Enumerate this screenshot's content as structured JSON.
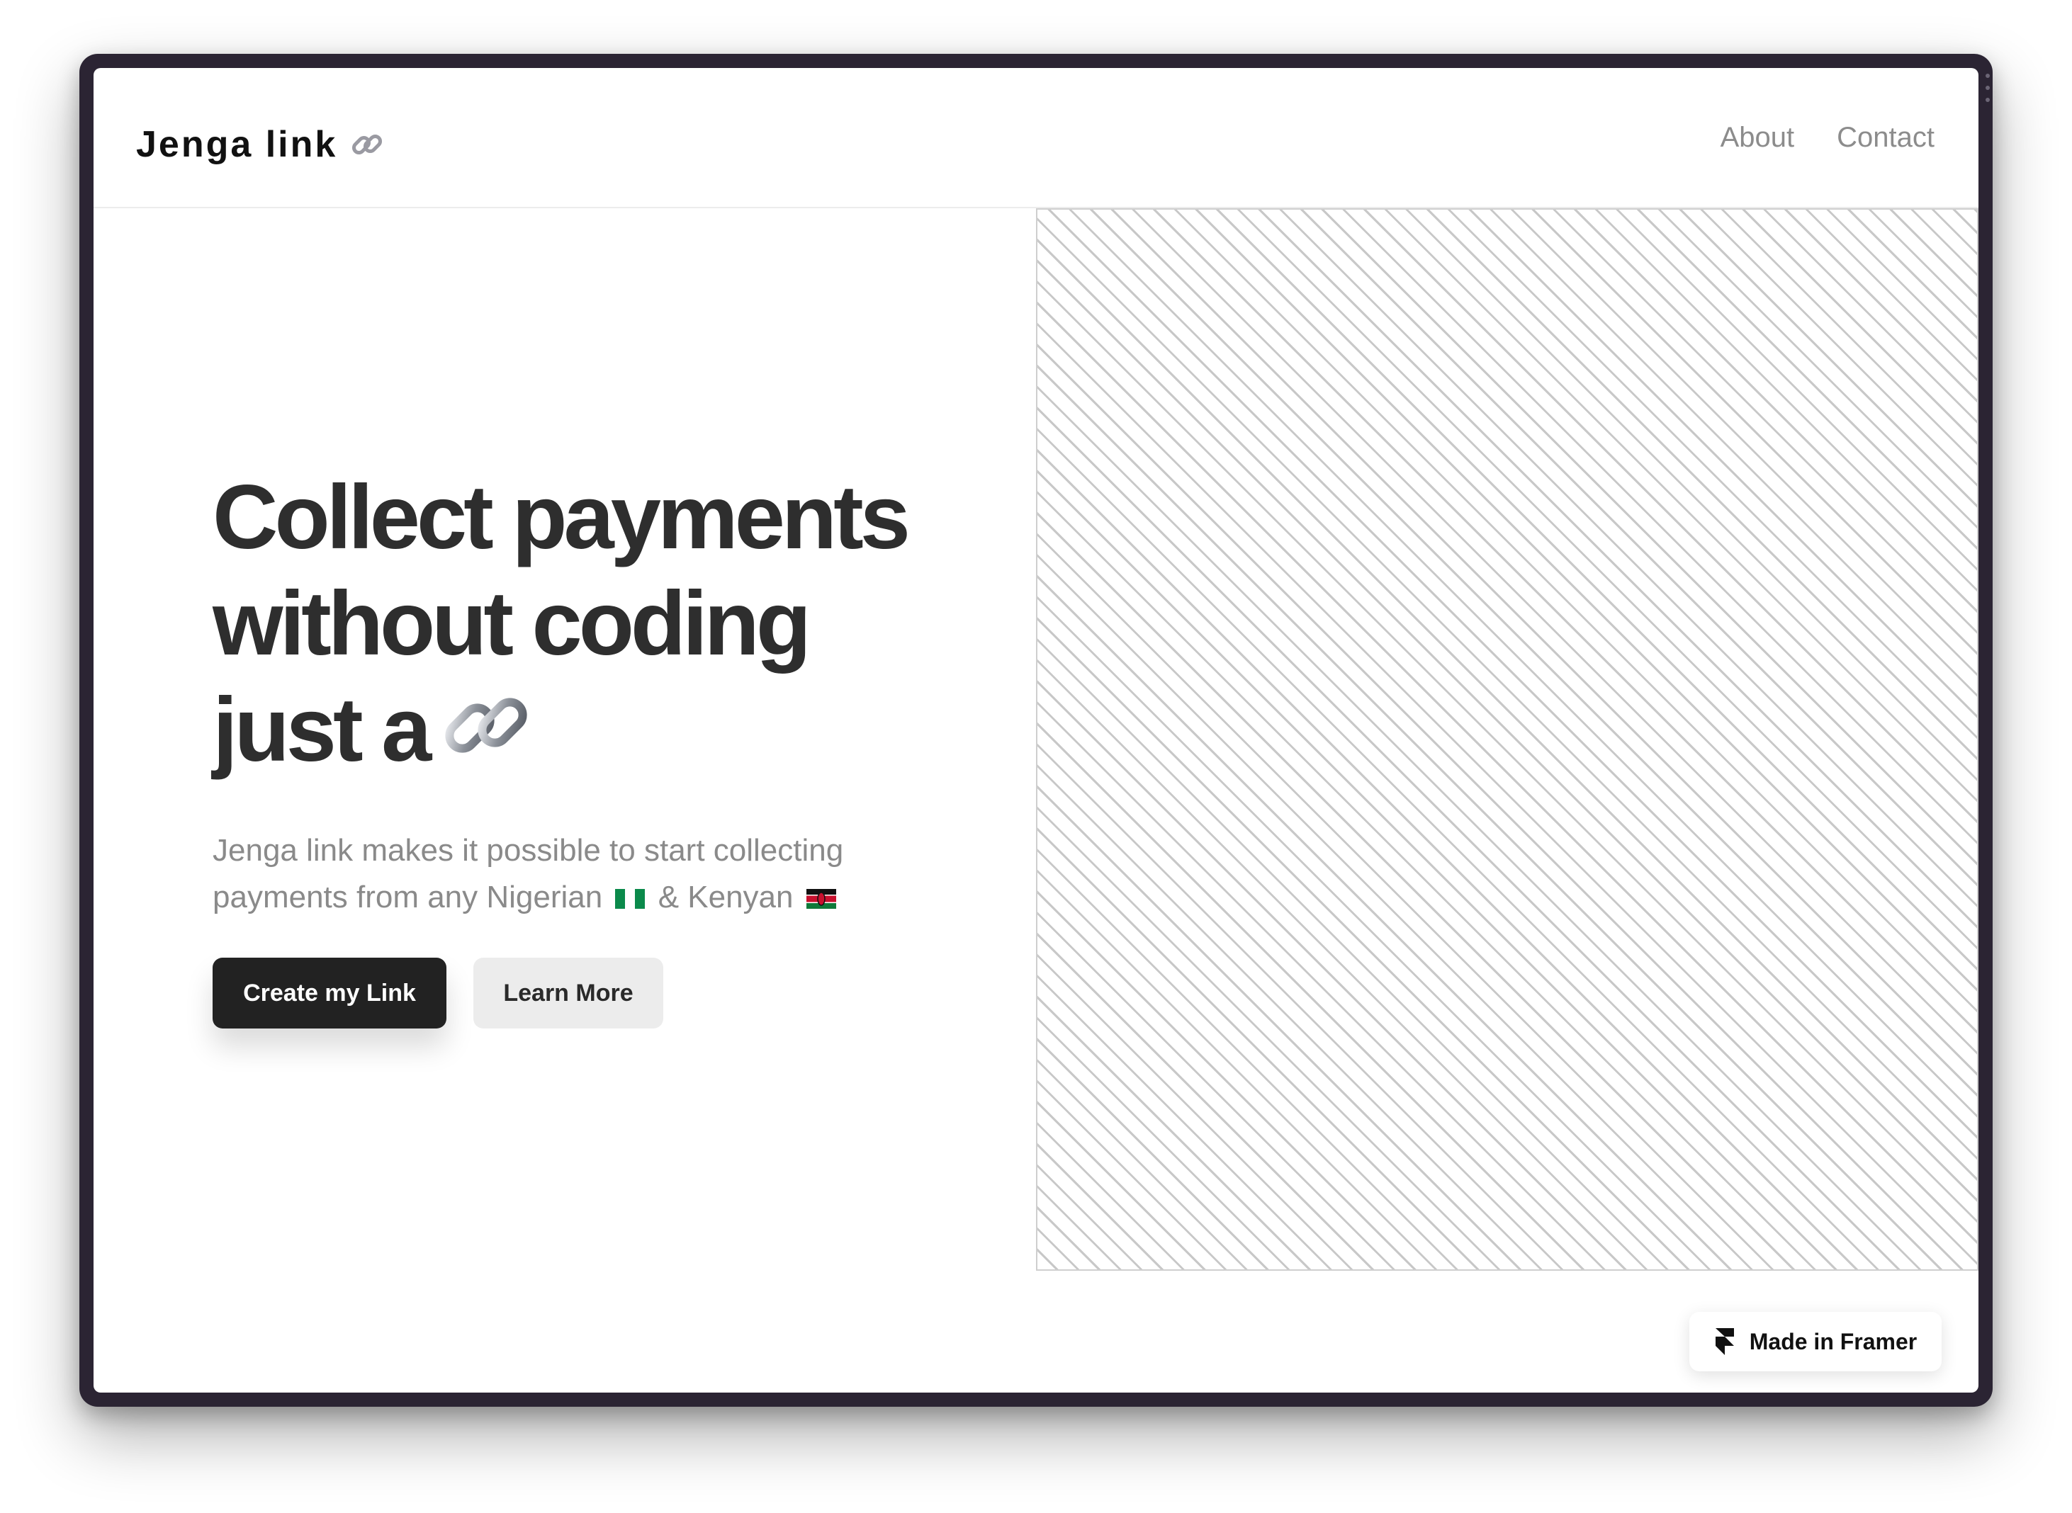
{
  "brand": {
    "name": "Jenga link",
    "icon": "link-icon"
  },
  "nav": {
    "links": [
      {
        "label": "About"
      },
      {
        "label": "Contact"
      }
    ]
  },
  "hero": {
    "headline_lines": [
      "Collect payments",
      "without coding",
      "just a"
    ],
    "headline_icon": "link-icon",
    "subtext_part1": "Jenga link makes it possible to start collecting payments from any Nigerian",
    "subtext_part2": "& Kenyan",
    "flags": [
      "nigeria-flag-icon",
      "kenya-flag-icon"
    ],
    "primary_button": "Create my Link",
    "secondary_button": "Learn More"
  },
  "badge": {
    "label": "Made in Framer",
    "icon": "framer-icon"
  },
  "colors": {
    "headline": "#2e2e2e",
    "primary_button_bg": "#222222",
    "secondary_button_bg": "#ececec",
    "nav_link": "#8c8c8c",
    "device_frame": "#2b2433"
  }
}
